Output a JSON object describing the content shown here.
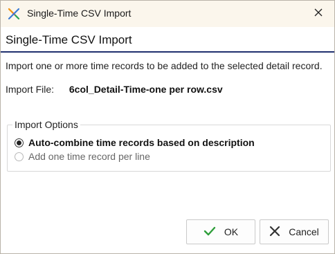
{
  "window": {
    "title": "Single-Time CSV Import"
  },
  "header": {
    "title": "Single-Time CSV Import"
  },
  "description": "Import one or more time records to be added to the selected detail record.",
  "import_file": {
    "label": "Import File:",
    "value": "6col_Detail-Time-one per row.csv"
  },
  "import_options": {
    "legend": "Import Options",
    "options": [
      {
        "label": "Auto-combine time records based on description",
        "selected": true
      },
      {
        "label": "Add one time record per line",
        "selected": false
      }
    ]
  },
  "buttons": {
    "ok": "OK",
    "cancel": "Cancel"
  },
  "colors": {
    "header_rule": "#1f2f6e",
    "ok_check": "#2e9e3a"
  }
}
